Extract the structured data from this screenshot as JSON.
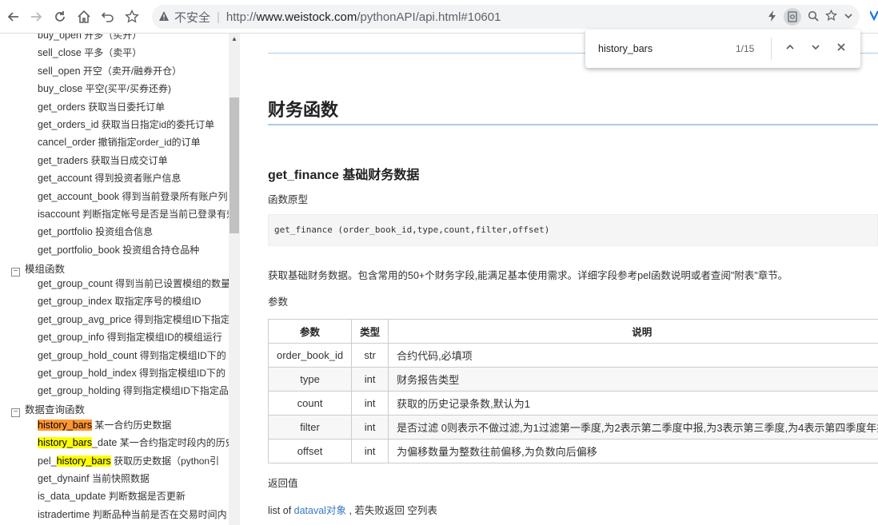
{
  "browser": {
    "security_label": "不安全",
    "separator": "|",
    "url_prefix": "http://",
    "url_host": "www.weistock.com",
    "url_path": "/pythonAPI/api.html#10601"
  },
  "find": {
    "query": "history_bars",
    "count": "1/15"
  },
  "sidebar": {
    "items_top": [
      {
        "fn": "buy_open",
        "cn": " 开多（买开）"
      },
      {
        "fn": "sell_close",
        "cn": " 平多（卖平）"
      },
      {
        "fn": "sell_open",
        "cn": " 开空（卖开/融券开仓）"
      },
      {
        "fn": "buy_close",
        "cn": " 平空(买平/买券还券)"
      },
      {
        "fn": "get_orders",
        "cn": " 获取当日委托订单"
      },
      {
        "fn": "get_orders_id",
        "cn": " 获取当日指定id的委托订单"
      },
      {
        "fn": "cancel_order",
        "cn": " 撤销指定order_id的订单"
      },
      {
        "fn": "get_traders",
        "cn": " 获取当日成交订单"
      },
      {
        "fn": "get_account",
        "cn": " 得到投资者账户信息"
      },
      {
        "fn": "get_account_book",
        "cn": " 得到当前登录所有账户列"
      },
      {
        "fn": "isaccount",
        "cn": " 判断指定帐号是否是当前已登录有效"
      },
      {
        "fn": "get_portfolio",
        "cn": " 投资组合信息"
      },
      {
        "fn": "get_portfolio_book",
        "cn": " 投资组合持仓品种"
      }
    ],
    "group1": "模组函数",
    "items_group1": [
      {
        "fn": "get_group_count",
        "cn": " 得到当前已设置模组的数量"
      },
      {
        "fn": "get_group_index",
        "cn": " 取指定序号的模组ID"
      },
      {
        "fn": "get_group_avg_price",
        "cn": " 得到指定模组ID下指定"
      },
      {
        "fn": "get_group_info",
        "cn": " 得到指定模组ID的模组运行"
      },
      {
        "fn": "get_group_hold_count",
        "cn": " 得到指定模组ID下的"
      },
      {
        "fn": "get_group_hold_index",
        "cn": " 得到指定模组ID下的"
      },
      {
        "fn": "get_group_holding",
        "cn": " 得到指定模组ID下指定品"
      }
    ],
    "group2": "数据查询函数",
    "hist1": {
      "hl": "history_bars",
      "cn": " 某一合约历史数据"
    },
    "hist2": {
      "hl": "history_bars",
      "rest": "_date",
      "cn": " 某一合约指定时段内的历史"
    },
    "hist3": {
      "pre": "pel_",
      "hl": "history_bars",
      "cn": " 获取历史数据（python引"
    },
    "items_group2": [
      {
        "fn": "get_dynainf",
        "cn": " 当前快照数据"
      },
      {
        "fn": "is_data_update",
        "cn": " 判断数据是否更新"
      },
      {
        "fn": "istradertime",
        "cn": " 判断品种当前是否在交易时间内"
      }
    ]
  },
  "content": {
    "section_title": "财务函数",
    "func_title": "get_finance 基础财务数据",
    "proto_label": "函数原型",
    "prototype": "get_finance (order_book_id,type,count,filter,offset)",
    "description": "获取基础财务数据。包含常用的50+个财务字段,能满足基本使用需求。详细字段参考pel函数说明或者查阅\"附表\"章节。",
    "params_label": "参数",
    "table": {
      "headers": [
        "参数",
        "类型",
        "说明"
      ],
      "rows": [
        {
          "name": "order_book_id",
          "type": "str",
          "desc": "合约代码,必填项",
          "link": false
        },
        {
          "name": "type",
          "type": "int",
          "desc": "财务报告类型",
          "link": true
        },
        {
          "name": "count",
          "type": "int",
          "desc": "获取的历史记录条数,默认为1",
          "link": false
        },
        {
          "name": "filter",
          "type": "int",
          "desc": "是否过滤 0则表示不做过滤,为1过滤第一季度,为2表示第二季度中报,为3表示第三季度,为4表示第四季度年报",
          "link": false
        },
        {
          "name": "offset",
          "type": "int",
          "desc": "为偏移数量为整数往前偏移,为负数向后偏移",
          "link": false
        }
      ]
    },
    "return_label": "返回值",
    "return_prefix": "list of ",
    "return_link": "dataval对象",
    "return_suffix": " , 若失败返回 空列表"
  }
}
